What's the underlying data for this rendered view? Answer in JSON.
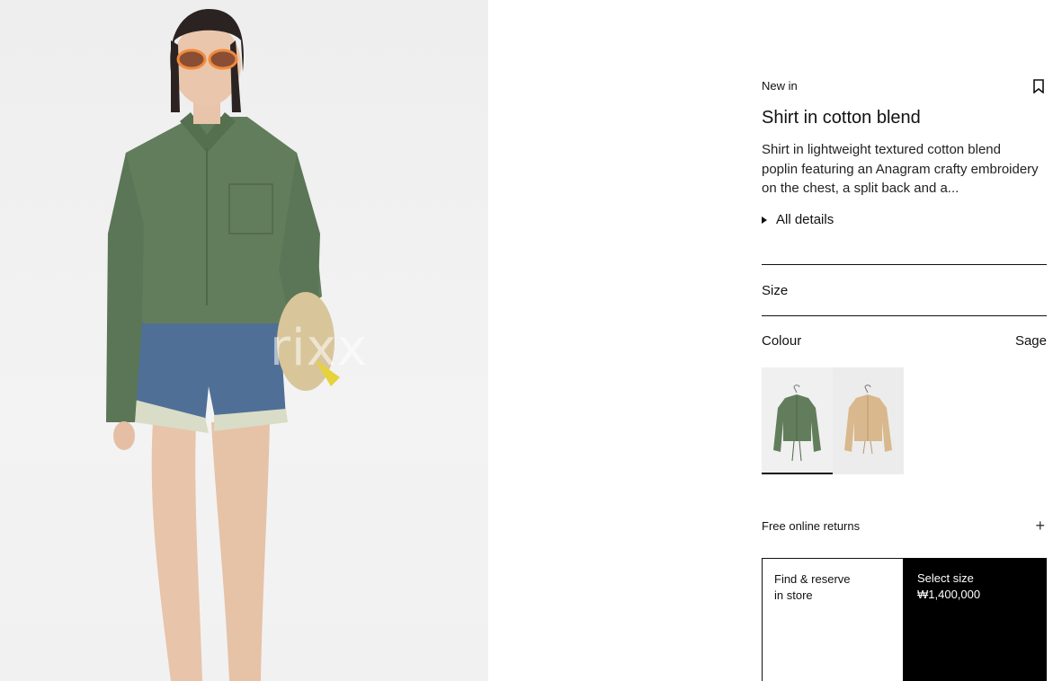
{
  "image": {
    "watermark": "rixx"
  },
  "product": {
    "tag": "New in",
    "title": "Shirt in cotton blend",
    "description": "Shirt in lightweight textured cotton blend poplin featuring an Anagram crafty embroidery on the chest, a split back and a...",
    "details_label": "All details"
  },
  "size": {
    "label": "Size"
  },
  "colour": {
    "label": "Colour",
    "selected": "Sage",
    "swatches": [
      {
        "name": "sage",
        "color": "#627d5c"
      },
      {
        "name": "sand",
        "color": "#d8b88c"
      }
    ]
  },
  "returns": {
    "label": "Free online returns",
    "icon": "plus-icon"
  },
  "actions": {
    "store_line1": "Find & reserve",
    "store_line2": "in store",
    "select_label": "Select size",
    "price": "₩1,400,000"
  },
  "colors": {
    "shirt": "#627d5c",
    "denim": "#4f6f96",
    "cta_bg": "#000000"
  }
}
